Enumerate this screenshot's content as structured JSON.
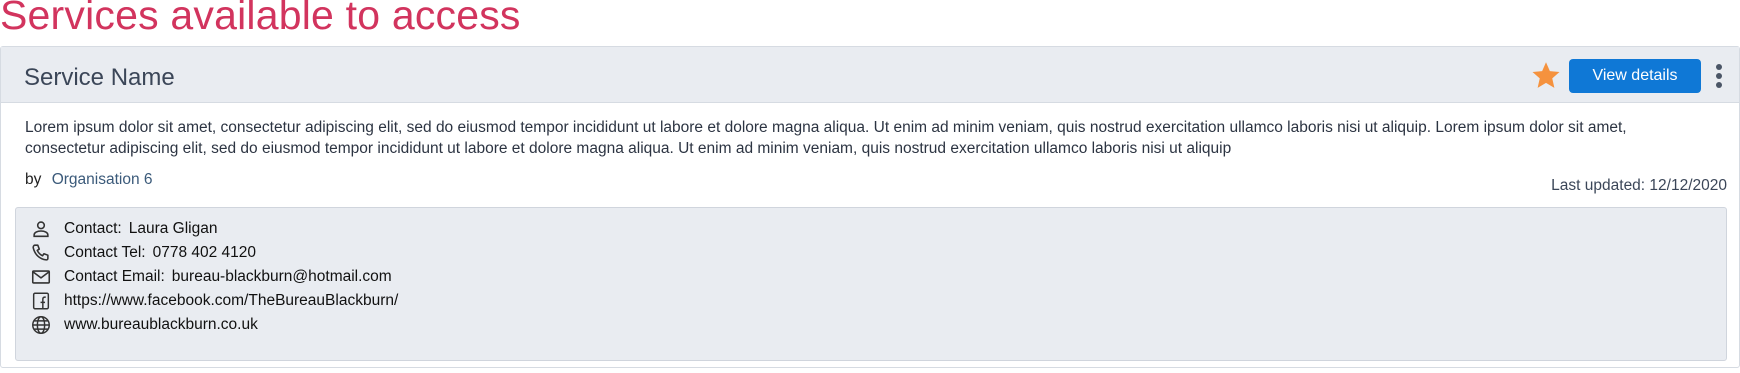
{
  "page": {
    "title": "Services available to access"
  },
  "service": {
    "name": "Service Name",
    "view_details_label": "View details",
    "description": "Lorem ipsum dolor sit amet, consectetur adipiscing elit, sed do eiusmod tempor incididunt ut labore et dolore magna aliqua. Ut enim ad minim veniam, quis nostrud exercitation ullamco laboris nisi ut aliquip. Lorem ipsum dolor sit amet, consectetur adipiscing elit, sed do eiusmod tempor incididunt ut labore et dolore magna aliqua. Ut enim ad minim veniam, quis nostrud exercitation ullamco laboris nisi ut aliquip",
    "by_label": "by",
    "organisation": "Organisation 6",
    "last_updated": "Last updated: 12/12/2020"
  },
  "contact": {
    "contact_label": "Contact:",
    "contact_name": "Laura Gligan",
    "tel_label": "Contact Tel:",
    "tel": "0778 402 4120",
    "email_label": "Contact Email:",
    "email": "bureau-blackburn@hotmail.com",
    "facebook": "https://www.facebook.com/TheBureauBlackburn/",
    "website": "www.bureaublackburn.co.uk"
  },
  "icons": {
    "favourite": "star-icon",
    "menu": "more-vertical-icon",
    "person": "person-icon",
    "phone": "phone-icon",
    "email": "mail-icon",
    "facebook": "facebook-icon",
    "website": "globe-icon"
  },
  "colors": {
    "title": "#d2345e",
    "button": "#0f78d6",
    "star": "#f5923e",
    "header_bg": "#e9ecf1"
  }
}
